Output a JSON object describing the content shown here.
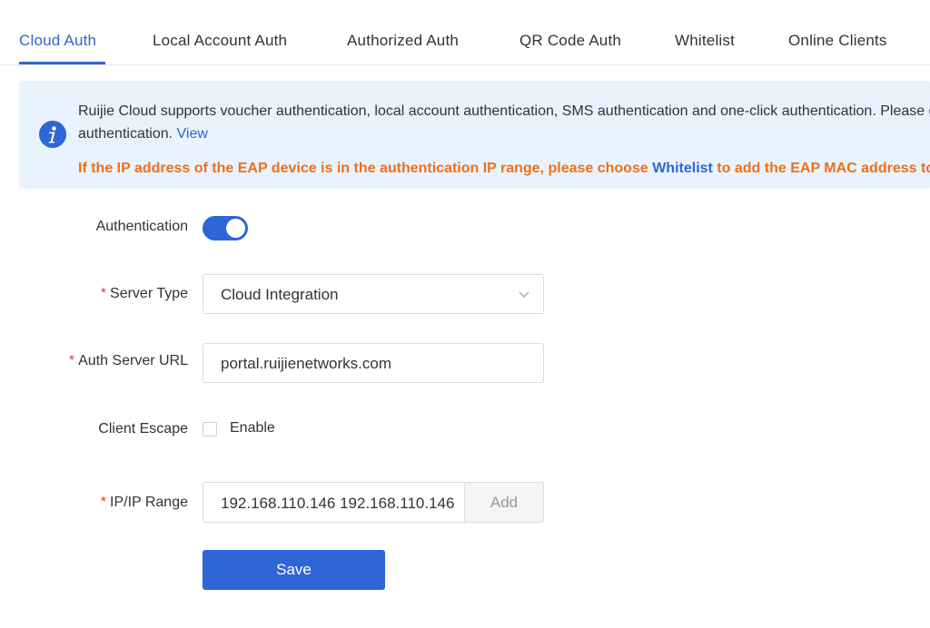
{
  "tabs": [
    {
      "label": "Cloud Auth",
      "active": true
    },
    {
      "label": "Local Account Auth"
    },
    {
      "label": "Authorized Auth"
    },
    {
      "label": "QR Code Auth"
    },
    {
      "label": "Whitelist"
    },
    {
      "label": "Online Clients"
    }
  ],
  "notice": {
    "icon": "info-icon",
    "line1": "Ruijie Cloud supports voucher authentication, local account authentication, SMS authentication and one-click authentication. Please go to Ruijie Cloud to configure the authentication.",
    "line2": "authentication.",
    "view_link": "View",
    "warning_before": "If the IP address of the EAP device is in the authentication IP range, please choose",
    "warning_link": "Whitelist",
    "warning_after": "to add the EAP MAC address to the whitelist."
  },
  "form": {
    "authentication": {
      "label": "Authentication",
      "enabled": true
    },
    "server_type": {
      "label": "Server Type",
      "required": "*",
      "value": "Cloud Integration"
    },
    "auth_server_url": {
      "label": "Auth Server URL",
      "required": "*",
      "value": "portal.ruijienetworks.com"
    },
    "client_escape": {
      "label": "Client Escape",
      "checkbox_label": "Enable",
      "checked": false
    },
    "ip_range": {
      "label": "IP/IP Range",
      "required": "*",
      "value": "192.168.110.146  192.168.110.146",
      "add_label": "Add"
    },
    "save_label": "Save"
  },
  "colors": {
    "accent": "#2f66d6",
    "warning": "#f07019",
    "required": "#e53935",
    "notice_bg": "#e8f3fd"
  }
}
